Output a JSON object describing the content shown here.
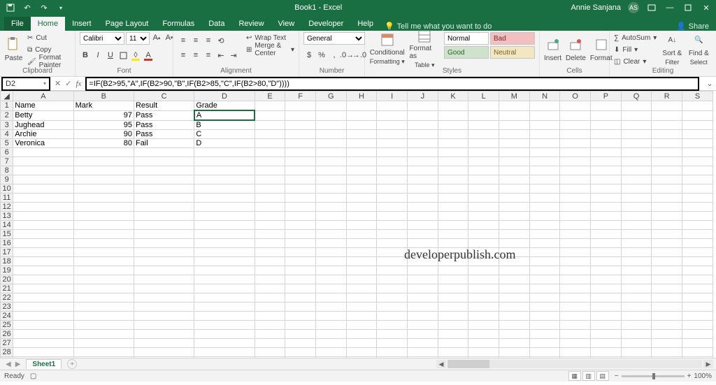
{
  "title": "Book1 - Excel",
  "user": {
    "name": "Annie Sanjana",
    "initials": "AS"
  },
  "tabs": {
    "file": "File",
    "home": "Home",
    "insert": "Insert",
    "pagelayout": "Page Layout",
    "formulas": "Formulas",
    "data": "Data",
    "review": "Review",
    "view": "View",
    "developer": "Developer",
    "help": "Help"
  },
  "tellme": "Tell me what you want to do",
  "share": "Share",
  "ribbon": {
    "clipboard": {
      "paste": "Paste",
      "cut": "Cut",
      "copy": "Copy",
      "fmtpainter": "Format Painter",
      "label": "Clipboard"
    },
    "font": {
      "name": "Calibri",
      "size": "11",
      "label": "Font"
    },
    "alignment": {
      "wrap": "Wrap Text",
      "merge": "Merge & Center",
      "label": "Alignment"
    },
    "number": {
      "format": "General",
      "label": "Number"
    },
    "styles": {
      "cond": "Conditional",
      "cond2": "Formatting",
      "fmt": "Format as",
      "fmt2": "Table",
      "normal": "Normal",
      "bad": "Bad",
      "good": "Good",
      "neutral": "Neutral",
      "label": "Styles"
    },
    "cells": {
      "insert": "Insert",
      "delete": "Delete",
      "format": "Format",
      "label": "Cells"
    },
    "editing": {
      "autosum": "AutoSum",
      "fill": "Fill",
      "clear": "Clear",
      "sort": "Sort &",
      "sort2": "Filter",
      "find": "Find &",
      "find2": "Select",
      "label": "Editing"
    }
  },
  "namebox": "D2",
  "formula": "=IF(B2>95,\"A\",IF(B2>90,\"B\",IF(B2>85,\"C\",IF(B2>80,\"D\"))))",
  "columns": [
    "A",
    "B",
    "C",
    "D",
    "E",
    "F",
    "G",
    "H",
    "I",
    "J",
    "K",
    "L",
    "M",
    "N",
    "O",
    "P",
    "Q",
    "R",
    "S"
  ],
  "headers": [
    "Name",
    "Mark",
    "Result",
    "Grade"
  ],
  "rows": [
    {
      "n": "Betty",
      "m": 97,
      "r": "Pass",
      "g": "A"
    },
    {
      "n": "Jughead",
      "m": 95,
      "r": "Pass",
      "g": "B"
    },
    {
      "n": "Archie",
      "m": 90,
      "r": "Pass",
      "g": "C"
    },
    {
      "n": "Veronica",
      "m": 80,
      "r": "Fail",
      "g": "D"
    }
  ],
  "watermark": "developerpublish.com",
  "sheet": "Sheet1",
  "status": "Ready",
  "zoom": "100%"
}
